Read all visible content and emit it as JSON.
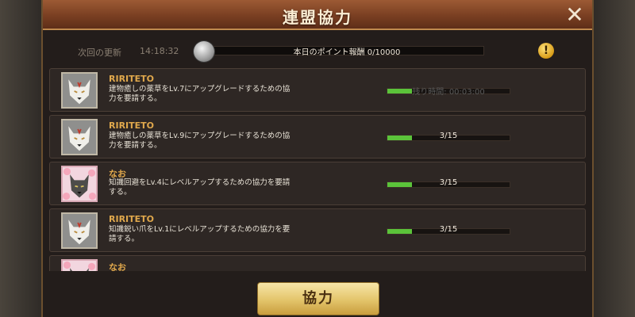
{
  "dialog": {
    "title": "連盟協力",
    "close_icon": "close-icon"
  },
  "points": {
    "update_label": "次回の更新",
    "update_time": "14:18:32",
    "reward_label": "本日のポイント報酬 0/10000",
    "reward_fraction": 0.0,
    "medal_icon": "silver-medal-icon",
    "info_icon": "info-icon"
  },
  "requests": [
    {
      "name": "RIRITETO",
      "text": "建物癒しの薬草をLv.7にアップグレードするための協力を要請する。",
      "progress_label": "残り時間: 00:03:00",
      "progress_fraction": 0.2,
      "avatar": "white-wolf-avatar"
    },
    {
      "name": "RIRITETO",
      "text": "建物癒しの薬草をLv.9にアップグレードするための協力を要請する。",
      "progress_label": "3/15",
      "progress_fraction": 0.2,
      "avatar": "white-wolf-avatar"
    },
    {
      "name": "なお",
      "text": "知識回避をLv.4にレベルアップするための協力を要請する。",
      "progress_label": "3/15",
      "progress_fraction": 0.2,
      "avatar": "grey-wolf-flower-avatar"
    },
    {
      "name": "RIRITETO",
      "text": "知識鋭い爪をLv.1にレベルアップするための協力を要請する。",
      "progress_label": "3/15",
      "progress_fraction": 0.2,
      "avatar": "white-wolf-avatar"
    },
    {
      "name": "なお",
      "text": "",
      "progress_label": "",
      "progress_fraction": 0,
      "avatar": "grey-wolf-flower-avatar"
    }
  ],
  "footer": {
    "help_label": "協力"
  },
  "colors": {
    "title_bar": "#8a4a2a",
    "progress_green": "#5bc33a",
    "name_gold": "#e0a84c",
    "button_gold": "#e3c46a"
  }
}
